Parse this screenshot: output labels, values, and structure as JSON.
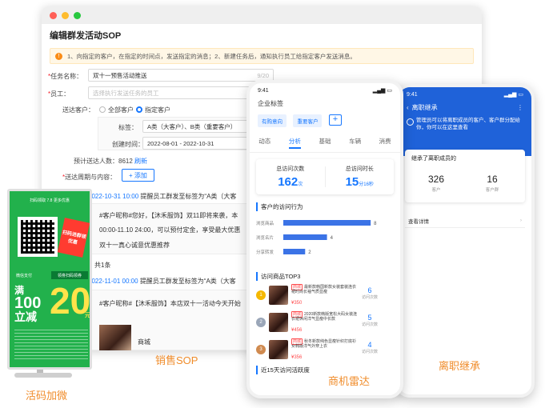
{
  "window": {
    "title": "编辑群发活动SOP",
    "notice": "1、向指定的客户，在指定的时间点，发送指定的消息；2、新建任务后，通知执行员工给指定客户发送消息。",
    "task_name_label": "任务名称：",
    "task_name_value": "双十一预售活动推送",
    "task_name_count": "9/20",
    "staff_label": "员工：",
    "staff_placeholder": "选择执行发送任务的员工",
    "send_customer_label": "送达客户：",
    "option_all": "全部客户",
    "option_specified": "指定客户",
    "tag_label": "标签：",
    "tag_value": "A类（大客户）、B类（重要客户）",
    "created_label": "创建时间：",
    "created_value": "2022-08-01 - 2022-10-31",
    "estimate_label": "预计送达人数：",
    "estimate_value": "8612",
    "refresh": "刷新",
    "cycle_label": "送达周期与内容：",
    "add_button": "+ 添加",
    "msg1_time": "2022-10-31 10:00",
    "msg1_text": "提醒员工群发至标签为“A类（大客",
    "msg1_body1": "#客户昵称#您好，【沐禾服饰】双11即将来袭，本",
    "msg1_body2": "00:00-11.10 24:00，可以预付定金，享受最大优惠",
    "msg1_body3": "双十一真心诚意优惠推荐",
    "total": "共1条",
    "msg2_time": "2022-11-01 00:00",
    "msg2_text": "提醒员工群发至标签为“A类（大客",
    "msg2_body": "#客户昵称#【沐禾服饰】本店双十一活动今天开始",
    "product_name": "商城"
  },
  "standee": {
    "top_text": "扫码领取 7.8 更多优惠",
    "badge": "扫码进群领优惠",
    "wechat_pay": "微信支付",
    "scan_tag": "领劵扫码领券",
    "man": "满",
    "hundred": "100",
    "li_jian": "立减",
    "twenty": "20",
    "yuan": "元"
  },
  "phone1": {
    "time": "9:41",
    "section_title": "企业标签",
    "tags": [
      "有购意向",
      "重要客户"
    ],
    "tabs": [
      "动态",
      "分析",
      "基础",
      "车辆",
      "消费"
    ],
    "active_tab": 1,
    "stat1_label": "总访问次数",
    "stat1_value": "162",
    "stat1_unit": "次",
    "stat2_label": "总访问时长",
    "stat2_value": "15",
    "stat2_unit": "分16秒",
    "behavior_title": "客户的访问行为",
    "goods_title": "访问商品TOP3",
    "goods": [
      {
        "rank": "1",
        "tag": "商城",
        "text": "最新款韩国新款女装套装连衣裙时尚长袖气质显瘦",
        "price": "¥350",
        "count": "6",
        "count_label": "访问次数",
        "medal": "#f5b800"
      },
      {
        "rank": "2",
        "tag": "商城",
        "text": "2020新款韩版宽松大码女装连衣裙休闲洋气显瘦中长款",
        "price": "¥456",
        "count": "5",
        "count_label": "访问次数",
        "medal": "#9aa6b8"
      },
      {
        "rank": "3",
        "tag": "商城",
        "text": "秋冬新款纯色显瘦针织打底衫女韩版洋气外穿上衣",
        "price": "¥356",
        "count": "4",
        "count_label": "访问次数",
        "medal": "#d08a4f"
      }
    ],
    "bottom_title": "近15天访问活跃度"
  },
  "chart_data": {
    "type": "bar",
    "orientation": "horizontal",
    "title": "客户的访问行为",
    "categories": [
      "浏览商品",
      "浏览名片",
      "分享转发"
    ],
    "values": [
      8,
      4,
      2
    ],
    "xlim": [
      0,
      8.5
    ],
    "color": "#3b73e6"
  },
  "phone2": {
    "time": "9:41",
    "title": "离职继承",
    "note": "管理员可以将离职成员的客户、客户群分配给你，你可以在这里查看",
    "card_title": "继承了离职成员的",
    "count1": "326",
    "count1_label": "客户",
    "count2": "16",
    "count2_label": "客户群",
    "list_item": "查看详情"
  },
  "captions": {
    "sales_sop": "销售SOP",
    "qr_add": "活码加微",
    "radar": "商机雷达",
    "inherit": "离职继承"
  },
  "colors": {
    "brand_blue": "#1677ff",
    "caption_orange": "#f08c2a",
    "standee_green": "#22b14c"
  }
}
